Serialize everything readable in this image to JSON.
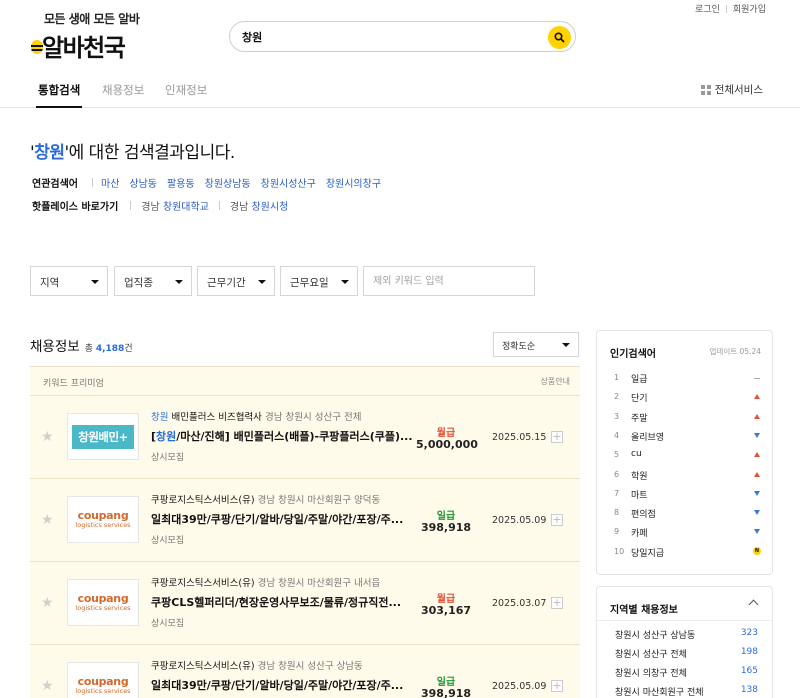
{
  "header": {
    "login": "로그인",
    "signup": "회원가입",
    "slogan": "모든 생애 모든 알바",
    "brand": "알바천국",
    "search_value": "창원"
  },
  "nav": {
    "tabs": [
      "통합검색",
      "채용정보",
      "인재정보"
    ],
    "all_services": "전체서비스"
  },
  "result": {
    "quote_open": "'",
    "keyword": "창원",
    "suffix": "'에 대한 검색결과입니다."
  },
  "related": {
    "label": "연관검색어",
    "items": [
      "마산",
      "상남동",
      "팔용동",
      "창원상남동",
      "창원시성산구",
      "창원시의창구"
    ]
  },
  "hotplace": {
    "label": "핫플레이스 바로가기",
    "items": [
      {
        "region": "경남",
        "name": "창원대학교"
      },
      {
        "region": "경남",
        "name": "창원시청"
      }
    ]
  },
  "filters": {
    "region": "지역",
    "industry": "업직종",
    "period": "근무기간",
    "days": "근무요일",
    "exclude_placeholder": "제외 키워드 입력"
  },
  "jobs": {
    "heading": "채용정보",
    "count_prefix": "총",
    "count": "4,188",
    "count_suffix": "건",
    "sort": "정확도순",
    "premium_label": "키워드 프리미엄",
    "product_guide": "상품안내",
    "items": [
      {
        "logo_type": "changwon",
        "logo_text": "창원배민+",
        "company_hl": "창원",
        "company": " 배민플러스 비즈협력사",
        "location": "경남 창원시 성산구 전체",
        "title_prefix": "[",
        "title_hl": "창원",
        "title": "/마산/진해] 배민플러스(배플)-쿠팡플러스(쿠플)...",
        "sub": "상시모집",
        "pay_type": "월급",
        "pay_class": "m",
        "pay": "5,000,000",
        "date": "2025.05.15"
      },
      {
        "logo_type": "coupang",
        "logo_text": "coupang",
        "logo_sub": "logistics services",
        "company_hl": "",
        "company": "쿠팡로지스틱스서비스(유)",
        "location": "경남 창원시 마산회원구 양덕동",
        "title_prefix": "",
        "title_hl": "",
        "title": "일최대39만/쿠팡/단기/알바/당일/주말/야간/포장/주...",
        "sub": "상시모집",
        "pay_type": "일급",
        "pay_class": "d",
        "pay": "398,918",
        "date": "2025.05.09"
      },
      {
        "logo_type": "coupang",
        "logo_text": "coupang",
        "logo_sub": "logistics services",
        "company_hl": "",
        "company": "쿠팡로지스틱스서비스(유)",
        "location": "경남 창원시 마산회원구 내서읍",
        "title_prefix": "",
        "title_hl": "",
        "title": "쿠팡CLS헬퍼리더/현장운영사무보조/물류/정규직전...",
        "sub": "상시모집",
        "pay_type": "월급",
        "pay_class": "m",
        "pay": "303,167",
        "date": "2025.03.07"
      },
      {
        "logo_type": "coupang",
        "logo_text": "coupang",
        "logo_sub": "logistics services",
        "company_hl": "",
        "company": "쿠팡로지스틱스서비스(유)",
        "location": "경남 창원시 성산구 상남동",
        "title_prefix": "",
        "title_hl": "",
        "title": "일최대39만/쿠팡/단기/알바/당일/주말/야간/포장/주...",
        "sub": "",
        "pay_type": "일급",
        "pay_class": "d",
        "pay": "398,918",
        "date": "2025.05.09"
      }
    ]
  },
  "popular": {
    "heading": "인기검색어",
    "updated": "업데이트 05.24",
    "items": [
      {
        "rank": "1",
        "term": "일급",
        "change": "same"
      },
      {
        "rank": "2",
        "term": "단기",
        "change": "up"
      },
      {
        "rank": "3",
        "term": "주말",
        "change": "up"
      },
      {
        "rank": "4",
        "term": "올리브영",
        "change": "dn"
      },
      {
        "rank": "5",
        "term": "cu",
        "change": "up"
      },
      {
        "rank": "6",
        "term": "학원",
        "change": "up"
      },
      {
        "rank": "7",
        "term": "마트",
        "change": "dn"
      },
      {
        "rank": "8",
        "term": "편의점",
        "change": "dn"
      },
      {
        "rank": "9",
        "term": "카페",
        "change": "dn"
      },
      {
        "rank": "10",
        "term": "당일지급",
        "change": "new"
      }
    ],
    "new_badge": "N"
  },
  "regional": {
    "heading": "지역별 채용정보",
    "items": [
      {
        "name": "창원시 성산구 상남동",
        "count": "323"
      },
      {
        "name": "창원시 성산구 전체",
        "count": "198"
      },
      {
        "name": "창원시 의창구 전체",
        "count": "165"
      },
      {
        "name": "창원시 마산회원구 전체",
        "count": "138"
      }
    ]
  },
  "colors": {
    "accent_yellow": "#ffd200",
    "link_blue": "#2a6dd8",
    "monthly_red": "#e0543d",
    "daily_green": "#229a35",
    "premium_bg": "#fffbea"
  }
}
